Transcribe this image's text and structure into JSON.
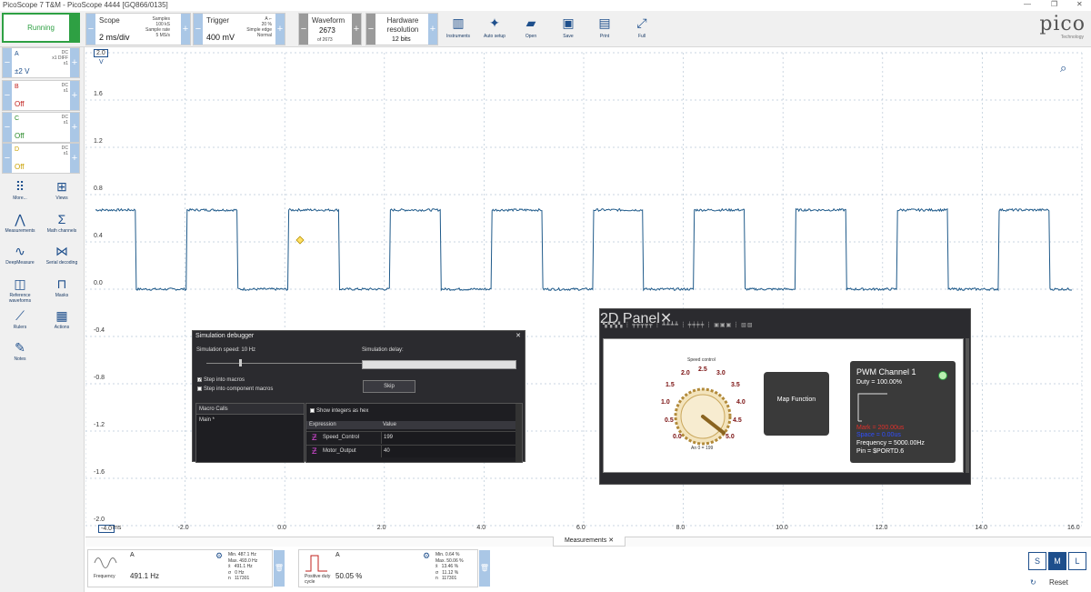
{
  "window": {
    "title": "PicoScope 7 T&M - PicoScope 4444 [GQ866/0135]",
    "controls": [
      "—",
      "❐",
      "✕"
    ]
  },
  "toolbar": {
    "run_status": "Running",
    "scope": {
      "label": "Scope",
      "value": "2 ms/div",
      "samples_label": "Samples",
      "samples": "100 kS",
      "rate_label": "Sample rate",
      "rate": "5 MS/s"
    },
    "trigger": {
      "label": "Trigger",
      "value": "400 mV",
      "pct": "20 %",
      "mode_label": "Simple edge",
      "mode": "Normal",
      "channel": "A"
    },
    "waveform": {
      "label": "Waveform",
      "value": "2673",
      "of": "of 2673"
    },
    "resolution": {
      "label": "Hardware resolution",
      "value": "12 bits"
    },
    "buttons": [
      {
        "label": "Instruments",
        "icon": "instruments-icon"
      },
      {
        "label": "Auto setup",
        "icon": "auto-setup-wand-icon"
      },
      {
        "label": "Open",
        "icon": "folder-open-icon"
      },
      {
        "label": "Save",
        "icon": "save-disk-icon"
      },
      {
        "label": "Print",
        "icon": "printer-icon"
      },
      {
        "label": "Full",
        "icon": "fullscreen-icon"
      }
    ],
    "logo": "pico",
    "logo_sub": "Technology"
  },
  "channels": [
    {
      "name": "A",
      "state": "±2 V",
      "coupling": "DC",
      "probe": "x1 DIFF",
      "attn": "x1",
      "color": "#1e4f8c"
    },
    {
      "name": "B",
      "state": "Off",
      "coupling": "DC",
      "probe": "x1",
      "attn": "",
      "color": "#c0201e"
    },
    {
      "name": "C",
      "state": "Off",
      "coupling": "DC",
      "probe": "x1",
      "attn": "",
      "color": "#2a8a2a"
    },
    {
      "name": "D",
      "state": "Off",
      "coupling": "DC",
      "probe": "x1",
      "attn": "",
      "color": "#c9a000"
    }
  ],
  "tools": [
    {
      "label": "More...",
      "icon": "more-dots-icon"
    },
    {
      "label": "Views",
      "icon": "views-grid-icon"
    },
    {
      "label": "Measurements",
      "icon": "measurements-icon"
    },
    {
      "label": "Math channels",
      "icon": "sigma-icon"
    },
    {
      "label": "DeepMeasure",
      "icon": "deepmeasure-icon"
    },
    {
      "label": "Serial decoding",
      "icon": "serial-decoding-icon"
    },
    {
      "label": "Reference waveforms",
      "icon": "reference-waveform-icon"
    },
    {
      "label": "Masks",
      "icon": "masks-icon"
    },
    {
      "label": "Rulers",
      "icon": "ruler-icon"
    },
    {
      "label": "Actions",
      "icon": "actions-clapper-icon"
    },
    {
      "label": "Notes",
      "icon": "notes-icon"
    }
  ],
  "plot": {
    "y_unit": "V",
    "y_ticks": [
      "2.0",
      "1.6",
      "1.2",
      "0.8",
      "0.4",
      "0.0",
      "-0.4",
      "-0.8",
      "-1.2",
      "-1.6",
      "-2.0"
    ],
    "x_ticks": [
      "-4.0",
      "-2.0",
      "0.0",
      "2.0",
      "4.0",
      "6.0",
      "8.0",
      "10.0",
      "12.0",
      "14.0",
      "16.0"
    ],
    "x_unit": "ms",
    "trace_color": "#1f5a8a",
    "high_level": 0.67,
    "low_level": 0.0,
    "period_ms": 2.036,
    "first_rise_ms": -4.0,
    "duty": 0.5
  },
  "measurements_tab": "Measurements",
  "measurements": [
    {
      "channel": "A",
      "name": "Frequency",
      "value": "491.1 Hz",
      "stats": [
        [
          "Min.",
          "487.1 Hz"
        ],
        [
          "Max.",
          "493.0 Hz"
        ],
        [
          "x̄",
          "491.1 Hz"
        ],
        [
          "σ",
          "0 Hz"
        ],
        [
          "n",
          "117301"
        ]
      ]
    },
    {
      "channel": "A",
      "name": "Positive duty cycle",
      "value": "50.05 %",
      "stats": [
        [
          "Min.",
          "0.64 %"
        ],
        [
          "Max.",
          "50.06 %"
        ],
        [
          "x̄",
          "13.46 %"
        ],
        [
          "σ",
          "11.12 %"
        ],
        [
          "n",
          "117301"
        ]
      ]
    }
  ],
  "view_size": [
    "S",
    "M",
    "L"
  ],
  "reset_label": "Reset",
  "sim_debugger": {
    "title": "Simulation debugger",
    "speed_label": "Simulation speed: 10 Hz",
    "delay_label": "Simulation delay:",
    "step_macros": "Step into macros",
    "step_component": "Step into component macros",
    "skip": "Skip",
    "macro_calls_header": "Macro Calls",
    "macro_item": "Main *",
    "show_hex": "Show integers as hex",
    "col_expression": "Expression",
    "col_value": "Value",
    "rows": [
      {
        "name": "Speed_Control",
        "value": "199"
      },
      {
        "name": "Motor_Output",
        "value": "40"
      }
    ]
  },
  "panel2d": {
    "title": "2D Panel",
    "dial_title": "Speed control",
    "dial_labels": [
      "0.0",
      "0.5",
      "1.0",
      "1.5",
      "2.0",
      "2.5",
      "3.0",
      "3.5",
      "4.0",
      "4.5",
      "5.0"
    ],
    "dial_readout": "An 0 = 199",
    "map_button": "Map Function",
    "pwm_title": "PWM Channel 1",
    "pwm_duty": "Duty = 100.00%",
    "pwm_mark": "Mark = 200.00us",
    "pwm_space": "Space = 0.00us",
    "pwm_freq": "Frequency = 5000.00Hz",
    "pwm_pin": "Pin = $PORTD.6"
  }
}
